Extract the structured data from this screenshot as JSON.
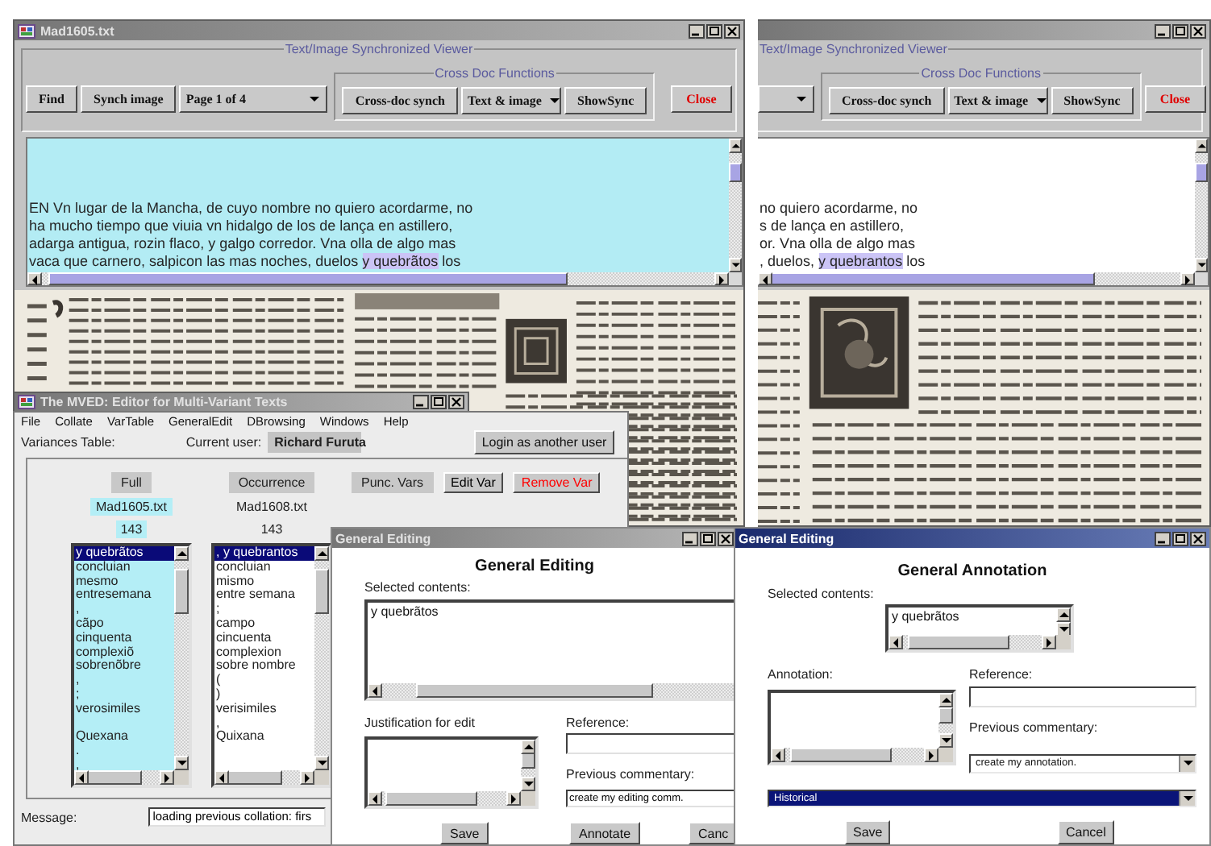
{
  "viewers": [
    {
      "title": "Mad1605.txt",
      "active": false,
      "group_title": "Text/Image Synchronized Viewer",
      "controls": [
        {
          "kind": "button",
          "label": "Find"
        },
        {
          "kind": "button",
          "label": "Synch image"
        },
        {
          "kind": "combo",
          "value": "Page 1 of 4"
        }
      ],
      "cross_doc": {
        "title": "Cross Doc Functions",
        "controls": [
          {
            "kind": "button",
            "label": "Cross-doc synch"
          },
          {
            "kind": "combo",
            "value": "Text & image"
          },
          {
            "kind": "button",
            "label": "ShowSync"
          }
        ]
      },
      "close_button": "Close",
      "pane_highlighted": true,
      "lines": [
        [
          {
            "text": "EN Vn lugar de la Mancha, de cuyo nombre no quiero acordarme, no",
            "highlighted": false
          }
        ],
        [
          {
            "text": "ha mucho tiempo que viuia vn hidalgo de los de lança en astillero,",
            "highlighted": false
          }
        ],
        [
          {
            "text": "adarga antigua, rozin flaco, y galgo corredor. Vna olla de algo mas",
            "highlighted": false
          }
        ],
        [
          {
            "text": "vaca que carnero, salpicon las mas noches, duelos ",
            "highlighted": false
          },
          {
            "text": "y quebrãtos",
            "highlighted": true
          },
          {
            "text": " los",
            "highlighted": false
          }
        ]
      ]
    },
    {
      "active": false,
      "group_title": "Text/Image Synchronized Viewer",
      "controls": [
        {
          "kind": "combo"
        }
      ],
      "cross_doc": {
        "title": "Cross Doc Functions",
        "controls": [
          {
            "kind": "button",
            "label": "Cross-doc synch"
          },
          {
            "kind": "combo",
            "value": "Text & image"
          },
          {
            "kind": "button",
            "label": "ShowSync"
          }
        ]
      },
      "close_button": "Close",
      "pane_highlighted": false,
      "lines": [
        [
          {
            "text": "no quiero acordarme, no",
            "highlighted": false
          }
        ],
        [
          {
            "text": "s de lança en astillero,",
            "highlighted": false
          }
        ],
        [
          {
            "text": "or. Vna olla de algo mas",
            "highlighted": false
          }
        ],
        [
          {
            "text": ", duelos, ",
            "highlighted": false
          },
          {
            "text": "y quebrantos",
            "highlighted": true
          },
          {
            "text": " los",
            "highlighted": false
          }
        ]
      ]
    }
  ],
  "mved": {
    "title": "The MVED: Editor for Multi-Variant Texts",
    "active": false,
    "menu": [
      "File",
      "Collate",
      "VarTable",
      "GeneralEdit",
      "DBrowsing",
      "Windows",
      "Help"
    ],
    "variances_label": "Variances Table:",
    "user_label": "Current user:",
    "user": "Richard Furuta",
    "login_button": "Login as another user",
    "header": [
      {
        "kind": "label",
        "label": "Full"
      },
      {
        "kind": "label",
        "label": "Occurrence"
      },
      {
        "kind": "label",
        "label": "Punc. Vars"
      },
      {
        "kind": "button",
        "label": "Edit Var",
        "color": "#000000"
      },
      {
        "kind": "button",
        "label": "Remove Var",
        "color": "#ff0000"
      }
    ],
    "columns": [
      {
        "file": "Mad1605.txt",
        "count": "143",
        "highlighted": true,
        "items": [
          {
            "kind": "item",
            "text": "y quebrãtos",
            "selected": true
          },
          {
            "kind": "item",
            "text": "concluian",
            "selected": false
          },
          {
            "kind": "item",
            "text": "mesmo",
            "selected": false
          },
          {
            "kind": "item",
            "text": "entresemana",
            "selected": false
          },
          {
            "kind": "item",
            "text": ",",
            "selected": false
          },
          {
            "kind": "item",
            "text": "cãpo",
            "selected": false
          },
          {
            "kind": "item",
            "text": "cinquenta",
            "selected": false
          },
          {
            "kind": "item",
            "text": "complexiõ",
            "selected": false
          },
          {
            "kind": "item",
            "text": "sobrenõbre",
            "selected": false
          },
          {
            "kind": "item",
            "text": ",",
            "selected": false
          },
          {
            "kind": "item",
            "text": ";",
            "selected": false
          },
          {
            "kind": "item",
            "text": "verosimiles",
            "selected": false
          },
          {
            "kind": "gap",
            "selected": false
          },
          {
            "kind": "item",
            "text": "Quexana",
            "selected": false
          },
          {
            "kind": "item",
            "text": ".",
            "selected": false
          },
          {
            "kind": "item",
            "text": ",",
            "selected": false
          }
        ]
      },
      {
        "file": "Mad1608.txt",
        "count": "143",
        "highlighted": false,
        "items": [
          {
            "kind": "item",
            "text": ", y quebrantos",
            "selected": true
          },
          {
            "kind": "item",
            "text": "concluian",
            "selected": false
          },
          {
            "kind": "item",
            "text": "mismo",
            "selected": false
          },
          {
            "kind": "item",
            "text": "entre semana",
            "selected": false
          },
          {
            "kind": "item",
            "text": ";",
            "selected": false
          },
          {
            "kind": "item",
            "text": "campo",
            "selected": false
          },
          {
            "kind": "item",
            "text": "cincuenta",
            "selected": false
          },
          {
            "kind": "item",
            "text": "complexion",
            "selected": false
          },
          {
            "kind": "item",
            "text": "sobre nombre",
            "selected": false
          },
          {
            "kind": "item",
            "text": "(",
            "selected": false
          },
          {
            "kind": "item",
            "text": ")",
            "selected": false
          },
          {
            "kind": "item",
            "text": "verisimiles",
            "selected": false
          },
          {
            "kind": "item",
            "text": ",",
            "selected": false
          },
          {
            "kind": "item",
            "text": "Quixana",
            "selected": false
          }
        ]
      }
    ],
    "message_label": "Message:",
    "message": "loading previous collation: firs"
  },
  "general_editing": {
    "title": "General Editing",
    "active": false,
    "heading": "General Editing",
    "selected_label": "Selected contents:",
    "selected_text": "y quebrãtos",
    "justification_label": "Justification for edit",
    "reference_label": "Reference:",
    "commentary_label": "Previous commentary:",
    "commentary": "create my editing comm.",
    "buttons": [
      "Save",
      "Annotate",
      "Canc"
    ]
  },
  "general_annotation": {
    "title": "General Editing",
    "active": true,
    "heading": "General Annotation",
    "selected_label": "Selected contents:",
    "selected_text": "y quebrãtos",
    "annotation_label": "Annotation:",
    "reference_label": "Reference:",
    "commentary_label": "Previous commentary:",
    "commentary": {
      "value": "create my annotation.",
      "focused": false
    },
    "category": {
      "value": "Historical",
      "focused": true
    },
    "buttons": [
      "Save",
      "Cancel"
    ]
  }
}
